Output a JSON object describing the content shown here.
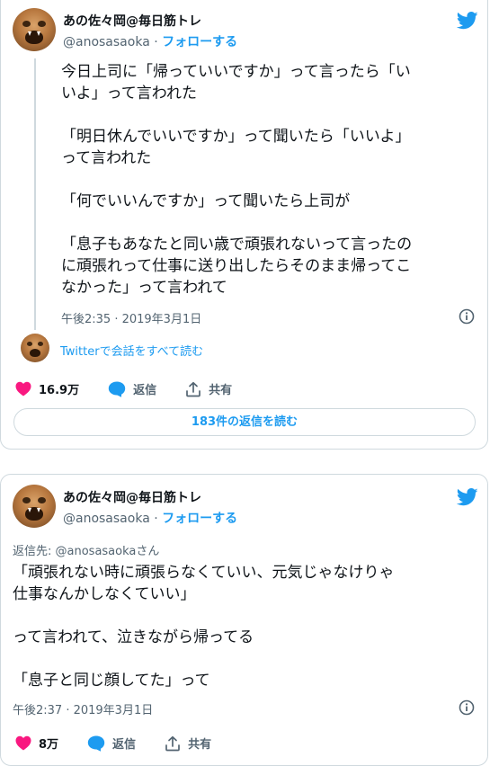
{
  "tweet1": {
    "author_name": "あの佐々岡@毎日筋トレ",
    "handle": "@anosasaoka",
    "separator": " · ",
    "follow_label": "フォローする",
    "text": "今日上司に「帰っていいですか」って言ったら「い\nいよ」って言われた\n\n「明日休んでいいですか」って聞いたら「いいよ」\nって言われた\n\n「何でいいんですか」って聞いたら上司が\n\n「息子もあなたと同い歳で頑張れないって言ったの\nに頑張れって仕事に送り出したらそのまま帰ってこ\nなかった」って言われて",
    "timestamp": "午後2:35 · 2019年3月1日",
    "read_conversation": "Twitterで会話をすべて読む",
    "likes": "16.9万",
    "reply_label": "返信",
    "share_label": "共有",
    "replies_button": "183件の返信を読む"
  },
  "tweet2": {
    "author_name": "あの佐々岡@毎日筋トレ",
    "handle": "@anosasaoka",
    "separator": " · ",
    "follow_label": "フォローする",
    "reply_to": "返信先: @anosasaokaさん",
    "text": "「頑張れない時に頑張らなくていい、元気じゃなけりゃ\n仕事なんかしなくていい」\n\nって言われて、泣きながら帰ってる\n\n「息子と同じ顔してた」って",
    "timestamp": "午後2:37 · 2019年3月1日",
    "likes": "8万",
    "reply_label": "返信",
    "share_label": "共有"
  },
  "colors": {
    "accent": "#1d9bf0",
    "like": "#f91880",
    "muted": "#536471",
    "border": "#cfd9de"
  },
  "icons": [
    "twitter-bird-icon",
    "info-icon",
    "heart-icon",
    "reply-bubble-icon",
    "share-icon"
  ]
}
